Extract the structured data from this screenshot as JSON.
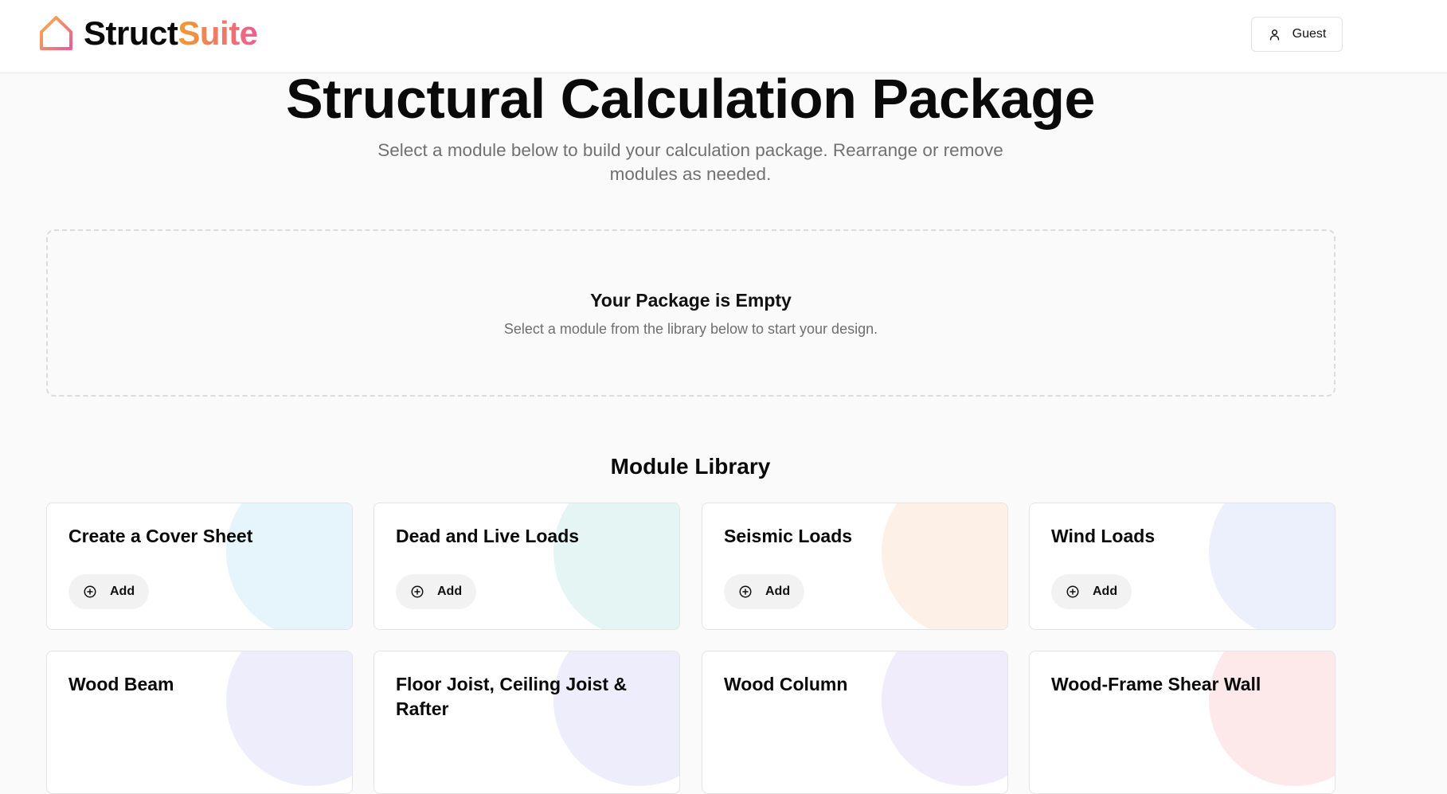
{
  "brand": {
    "name_part1": "Struct",
    "name_part2": "Suite"
  },
  "header": {
    "user_label": "Guest"
  },
  "page": {
    "title": "Structural Calculation Package",
    "subtitle": "Select a module below to build your calculation package. Rearrange or remove modules as needed."
  },
  "package": {
    "empty_title": "Your Package is Empty",
    "empty_text": "Select a module from the library below to start your design."
  },
  "library": {
    "title": "Module Library",
    "add_label": "Add",
    "modules": [
      {
        "title": "Create a Cover Sheet",
        "color": "#e6f4fb"
      },
      {
        "title": "Dead and Live Loads",
        "color": "#e5f5f3"
      },
      {
        "title": "Seismic Loads",
        "color": "#fdf0e6"
      },
      {
        "title": "Wind Loads",
        "color": "#ebf0fc"
      },
      {
        "title": "Wood Beam",
        "color": "#eeedfb"
      },
      {
        "title": "Floor Joist, Ceiling Joist & Rafter",
        "color": "#eeedfb"
      },
      {
        "title": "Wood Column",
        "color": "#f0ecfb"
      },
      {
        "title": "Wood-Frame Shear Wall",
        "color": "#fde8ea"
      }
    ]
  }
}
